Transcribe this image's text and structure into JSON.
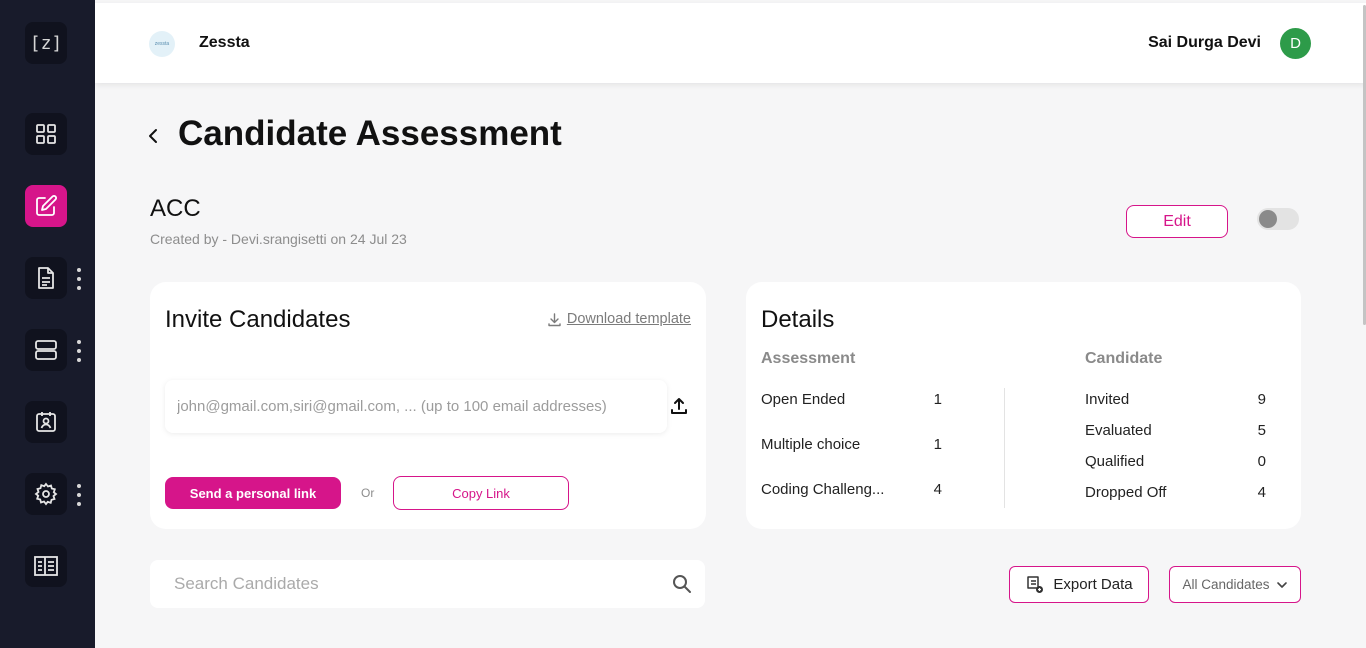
{
  "sidebar": {
    "logo": "[z]",
    "items": [
      {
        "icon": "dashboard-grid-icon"
      },
      {
        "icon": "edit-icon",
        "active": true
      },
      {
        "icon": "document-icon",
        "has_menu": true
      },
      {
        "icon": "server-icon",
        "has_menu": true
      },
      {
        "icon": "calendar-id-icon"
      },
      {
        "icon": "settings-gear-icon",
        "has_menu": true
      },
      {
        "icon": "building-icon"
      }
    ]
  },
  "header": {
    "org_logo_text": "zessta",
    "org_name": "Zessta",
    "user_name": "Sai Durga Devi",
    "avatar_initial": "D"
  },
  "page": {
    "title": "Candidate Assessment",
    "assessment_name": "ACC",
    "created_by": "Created by - Devi.srangisetti on 24 Jul 23",
    "edit_label": "Edit",
    "toggle_on": false
  },
  "invite": {
    "title": "Invite Candidates",
    "download_template": "Download template",
    "email_placeholder": "john@gmail.com,siri@gmail.com, ... (up to 100 email addresses)",
    "send_label": "Send a personal link",
    "or_label": "Or",
    "copy_label": "Copy Link"
  },
  "details": {
    "title": "Details",
    "assessment_head": "Assessment",
    "candidate_head": "Candidate",
    "assessment_rows": [
      {
        "label": "Open Ended",
        "value": "1"
      },
      {
        "label": "Multiple choice",
        "value": "1"
      },
      {
        "label": "Coding Challeng...",
        "value": "4"
      }
    ],
    "candidate_rows": [
      {
        "label": "Invited",
        "value": "9"
      },
      {
        "label": "Evaluated",
        "value": "5"
      },
      {
        "label": "Qualified",
        "value": "0"
      },
      {
        "label": "Dropped Off",
        "value": "4"
      }
    ]
  },
  "toolbar": {
    "search_placeholder": "Search Candidates",
    "export_label": "Export Data",
    "filter_selected": "All Candidates"
  },
  "colors": {
    "accent": "#d6158a",
    "sidebar_bg": "#181b2b",
    "avatar_bg": "#2d9b49"
  }
}
